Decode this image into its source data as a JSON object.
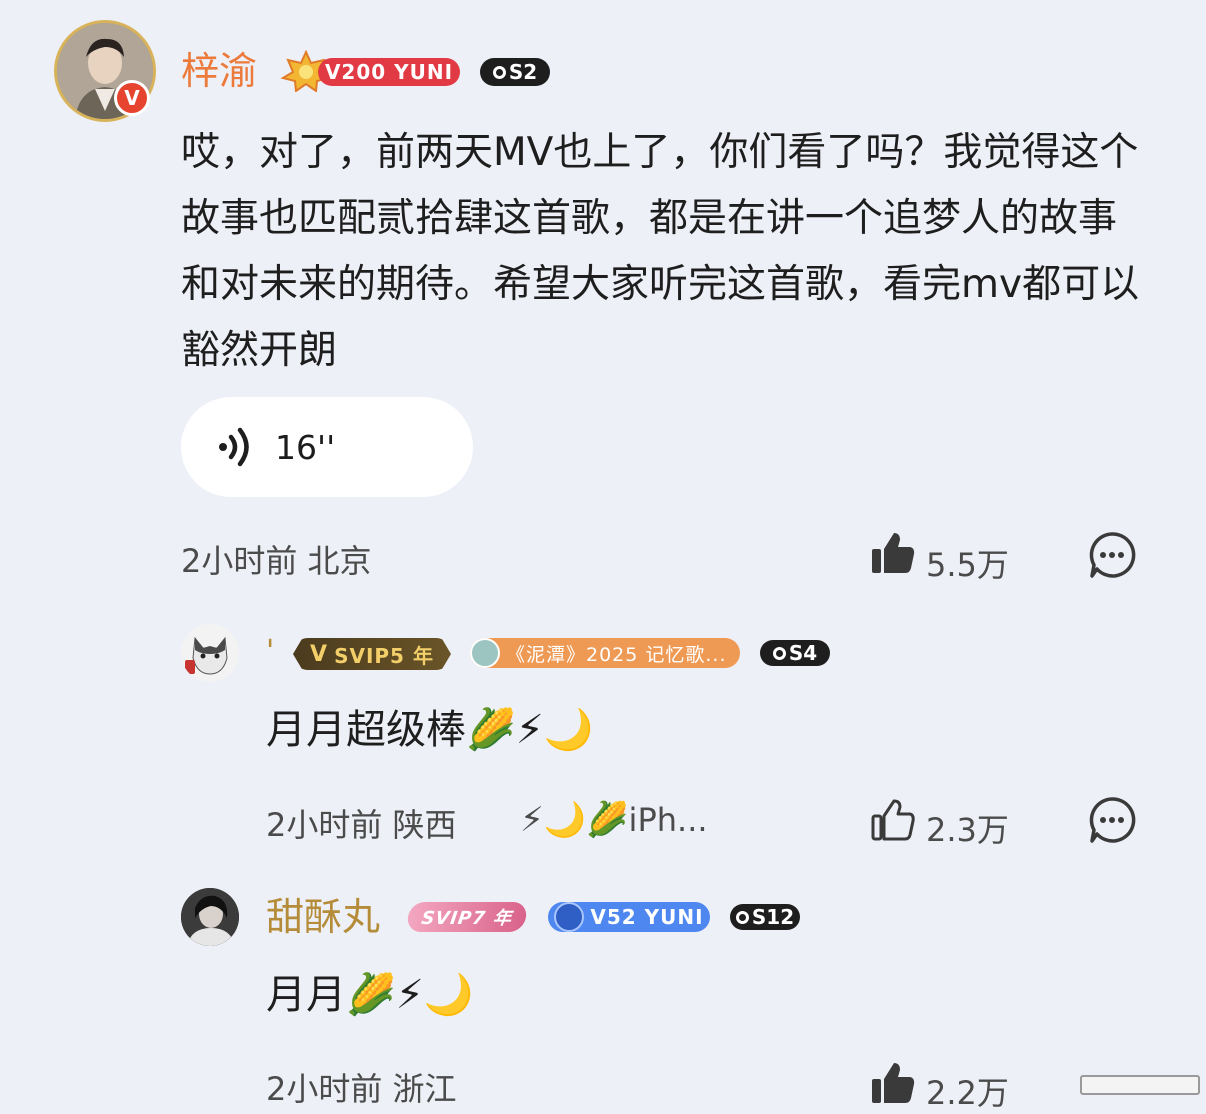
{
  "post": {
    "author": "梓渝",
    "vip_badge": "V200 YUNI",
    "level_badge": "S2",
    "verified_mark": "V",
    "text": "哎，对了，前两天MV也上了，你们看了吗？我觉得这个故事也匹配贰拾肆这首歌，都是在讲一个追梦人的故事和对未来的期待。希望大家听完这首歌，看完mv都可以豁然开朗",
    "voice_duration": "16''",
    "time": "2小时前",
    "location": "北京",
    "likes": "5.5万"
  },
  "replies": [
    {
      "name": "'",
      "svip_badge": "SVIP5 年",
      "event_badge": "《泥潭》2025 记忆歌...",
      "level_badge": "S4",
      "text": "月月超级棒",
      "emojis": "🌽⚡🌙",
      "time": "2小时前",
      "location": "陕西",
      "device_emojis": "⚡🌙🌽",
      "device": "iPh...",
      "likes": "2.3万"
    },
    {
      "name": "甜酥丸",
      "svip_badge": "SVIP7 年",
      "vip_badge": "V52 YUNI",
      "level_badge": "S12",
      "text": "月月",
      "emojis": "🌽⚡🌙",
      "time": "2小时前",
      "location": "浙江",
      "likes": "2.2万"
    }
  ],
  "colors": {
    "background": "#eef0f7",
    "author_name": "#eb7a3b",
    "reply_name": "#b58c39",
    "vip_red": "#e23a45",
    "svip_gold": "#e0b545",
    "event_orange": "#ef9a54",
    "vip_blue": "#4e87ef"
  }
}
